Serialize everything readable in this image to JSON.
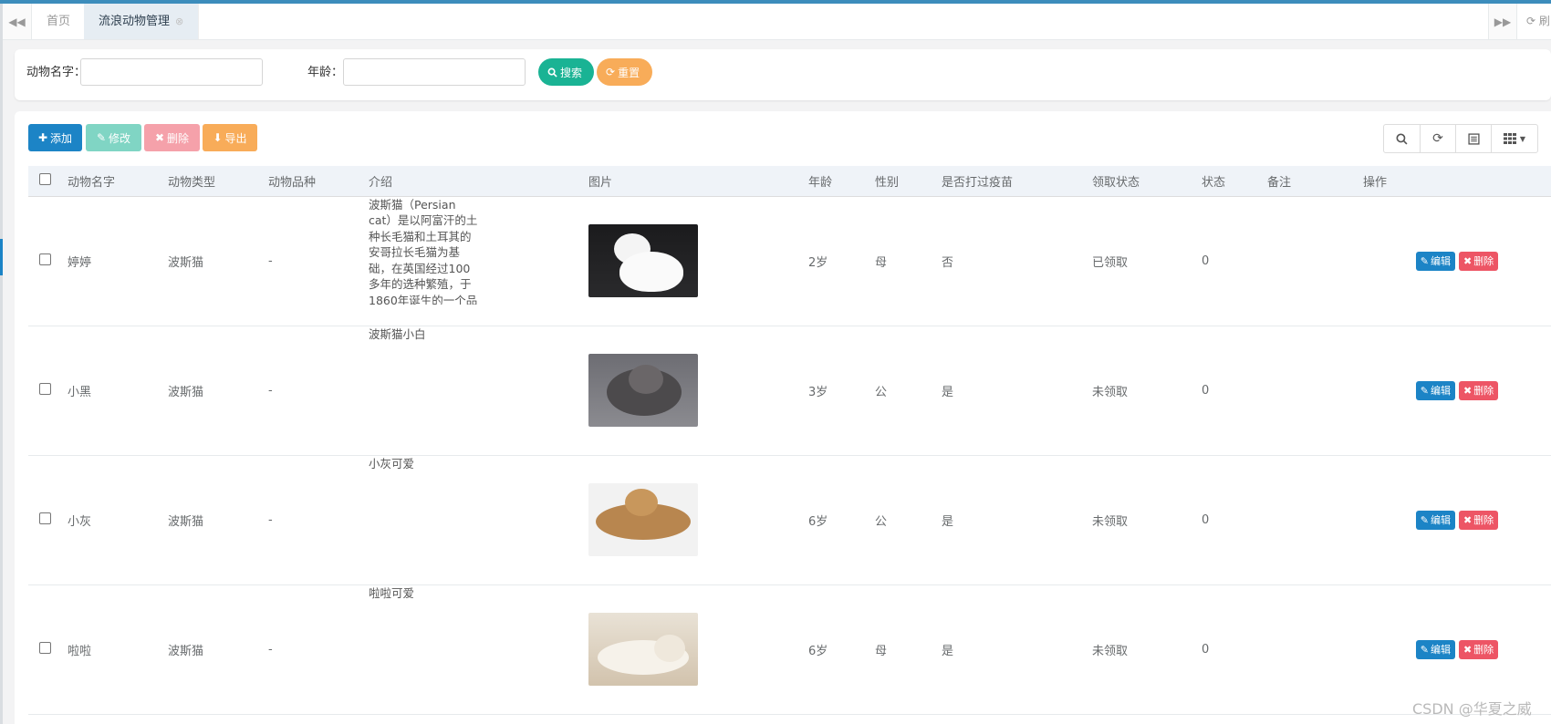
{
  "tabs": {
    "home": "首页",
    "active": "流浪动物管理",
    "refresh": "刷"
  },
  "search": {
    "name_label": "动物名字：",
    "name_value": "",
    "age_label": "年龄：",
    "age_value": "",
    "search_button": "搜索",
    "reset_button": "重置"
  },
  "toolbar": {
    "add": "添加",
    "edit": "修改",
    "delete": "删除",
    "export": "导出"
  },
  "columns": [
    "动物名字",
    "动物类型",
    "动物品种",
    "介绍",
    "图片",
    "年龄",
    "性别",
    "是否打过疫苗",
    "领取状态",
    "状态",
    "备注",
    "操作"
  ],
  "rows": [
    {
      "name": "婷婷",
      "type": "波斯猫",
      "breed": "-",
      "intro": "波斯猫（Persian cat）是以阿富汗的土种长毛猫和土耳其的安哥拉长毛猫为基础，在英国经过100多年的选种繁殖，于1860年诞生的一个品",
      "image_icon": "white-persian-cat-photo",
      "age": "2岁",
      "gender": "母",
      "vaccinated": "否",
      "adopt_status": "已领取",
      "status": "0",
      "remark": ""
    },
    {
      "name": "小黑",
      "type": "波斯猫",
      "breed": "-",
      "intro": "波斯猫小白",
      "image_icon": "grey-persian-cat-photo",
      "age": "3岁",
      "gender": "公",
      "vaccinated": "是",
      "adopt_status": "未领取",
      "status": "0",
      "remark": ""
    },
    {
      "name": "小灰",
      "type": "波斯猫",
      "breed": "-",
      "intro": "小灰可爱",
      "image_icon": "orange-persian-cat-photo",
      "age": "6岁",
      "gender": "公",
      "vaccinated": "是",
      "adopt_status": "未领取",
      "status": "0",
      "remark": ""
    },
    {
      "name": "啦啦",
      "type": "波斯猫",
      "breed": "-",
      "intro": "啦啦可爱",
      "image_icon": "cream-persian-cat-photo",
      "age": "6岁",
      "gender": "母",
      "vaccinated": "是",
      "adopt_status": "未领取",
      "status": "0",
      "remark": ""
    }
  ],
  "row_actions": {
    "edit": "编辑",
    "delete": "删除"
  },
  "watermark": "CSDN @华夏之威",
  "colors": {
    "primary": "#1c84c6",
    "success": "#1ab394",
    "danger": "#ed5565",
    "warning": "#f8ac59"
  }
}
